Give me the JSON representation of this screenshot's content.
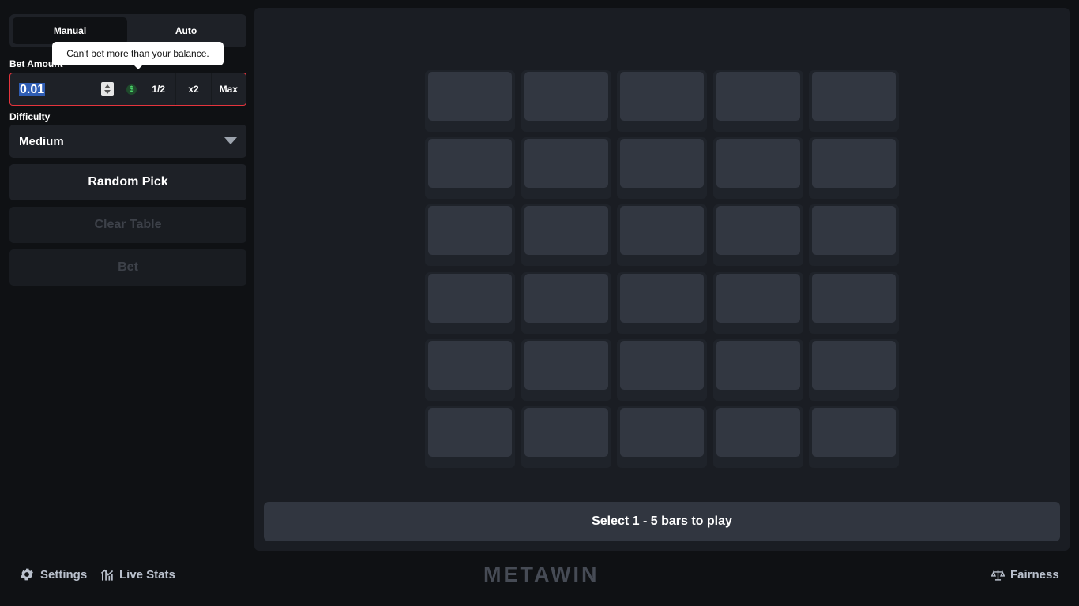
{
  "mode_tabs": {
    "manual": "Manual",
    "auto": "Auto",
    "active": "manual"
  },
  "tooltip": {
    "text": "Can't bet more than your balance."
  },
  "bet": {
    "label": "Bet Amount",
    "value": "0.01",
    "currency_symbol": "$",
    "half_label": "1/2",
    "double_label": "x2",
    "max_label": "Max"
  },
  "difficulty": {
    "label": "Difficulty",
    "selected": "Medium"
  },
  "buttons": {
    "random_pick": "Random Pick",
    "clear_table": "Clear Table",
    "bet": "Bet"
  },
  "grid": {
    "rows": 6,
    "cols": 5
  },
  "status": {
    "message": "Select 1 - 5 bars to play"
  },
  "footer": {
    "settings": "Settings",
    "live_stats": "Live Stats",
    "logo": "METAWIN",
    "fairness": "Fairness"
  },
  "colors": {
    "background": "#0f1114",
    "panel": "#1e2127",
    "game_area": "#1a1d23",
    "bar_face": "#323741",
    "error_border": "#e5343d",
    "currency_green": "#4cd66b"
  },
  "icons": {
    "settings": "gear-icon",
    "live_stats": "bar-chart-icon",
    "fairness": "scale-icon",
    "spinner": "number-spinner-icon",
    "dropdown": "caret-down-icon"
  }
}
